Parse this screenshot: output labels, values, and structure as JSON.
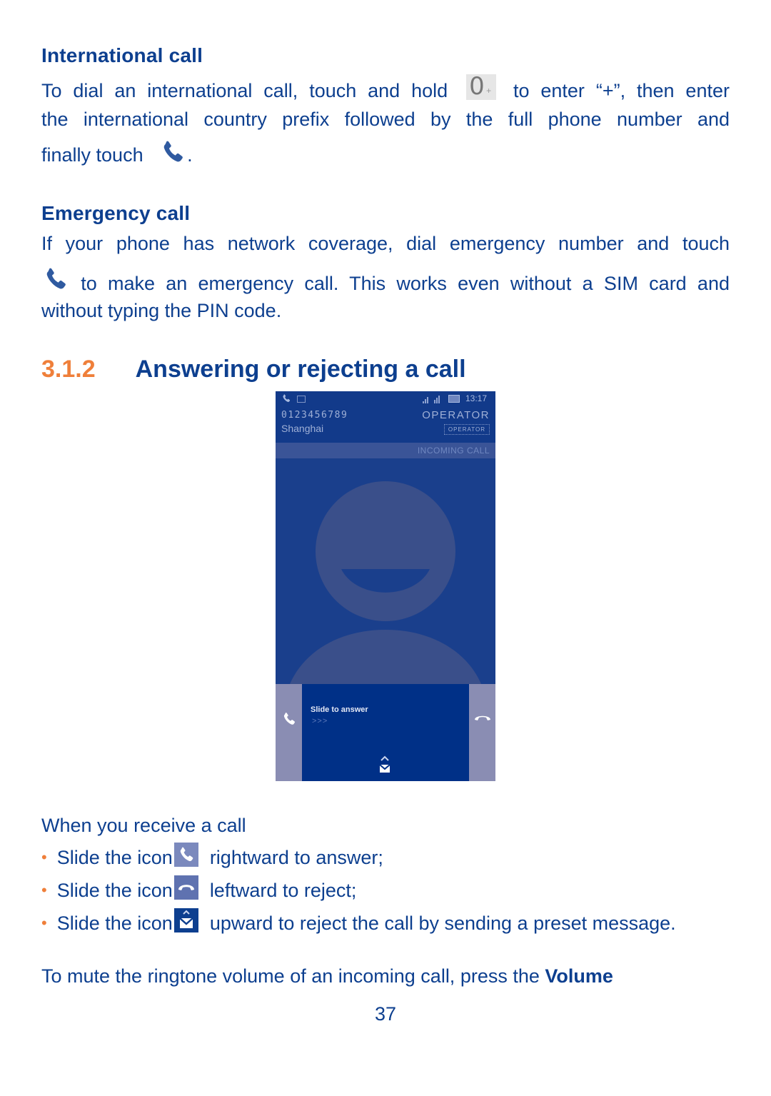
{
  "international_call": {
    "heading": "International call",
    "line1_before": "To dial an international call, touch and hold",
    "key_icon": "zero-plus-key-icon",
    "key_main": "0",
    "key_sub": "+",
    "line1_after": "to enter “+”, then enter",
    "line2": "the international country prefix followed by the full phone number and",
    "line3_before": "finally touch",
    "line3_icon": "phone-call-icon",
    "line3_after": "."
  },
  "emergency_call": {
    "heading": "Emergency call",
    "line1": "If your phone has network coverage, dial emergency number and touch",
    "line2_icon": "phone-call-icon",
    "line2": "to make an emergency call. This works even without a SIM card and",
    "line3": "without typing the PIN code."
  },
  "section": {
    "number": "3.1.2",
    "title": "Answering or rejecting a call"
  },
  "phone_screen": {
    "status_time": "13:17",
    "caller_number": "0123456789",
    "caller_location": "Shanghai",
    "operator": "OPERATOR",
    "operator_badge": "OPERATOR",
    "call_state": "INCOMING CALL",
    "slide_hint": "Slide to answer",
    "slide_chevrons": ">>>",
    "colors": {
      "background": "#1a3f8c",
      "header": "#123a8a",
      "avatar": "#3a4f8a",
      "answer_panel": "#003087",
      "side_panels": "#8a8db3"
    }
  },
  "receive_call": {
    "intro": "When you receive a call",
    "bullets": [
      {
        "before": "Slide the icon",
        "icon": "answer-call-icon",
        "after": "rightward to answer;"
      },
      {
        "before": "Slide the icon",
        "icon": "reject-call-icon",
        "after": "leftward to reject;"
      },
      {
        "before": "Slide the icon",
        "icon": "message-reject-icon",
        "after": "upward to reject the call by sending a preset message."
      }
    ]
  },
  "mute_note": {
    "text": "To mute the ringtone volume of an incoming call, press the",
    "bold": "Volume"
  },
  "page_number": "37",
  "colors": {
    "text": "#0d3f8f",
    "accent_orange": "#ef7f3a"
  }
}
